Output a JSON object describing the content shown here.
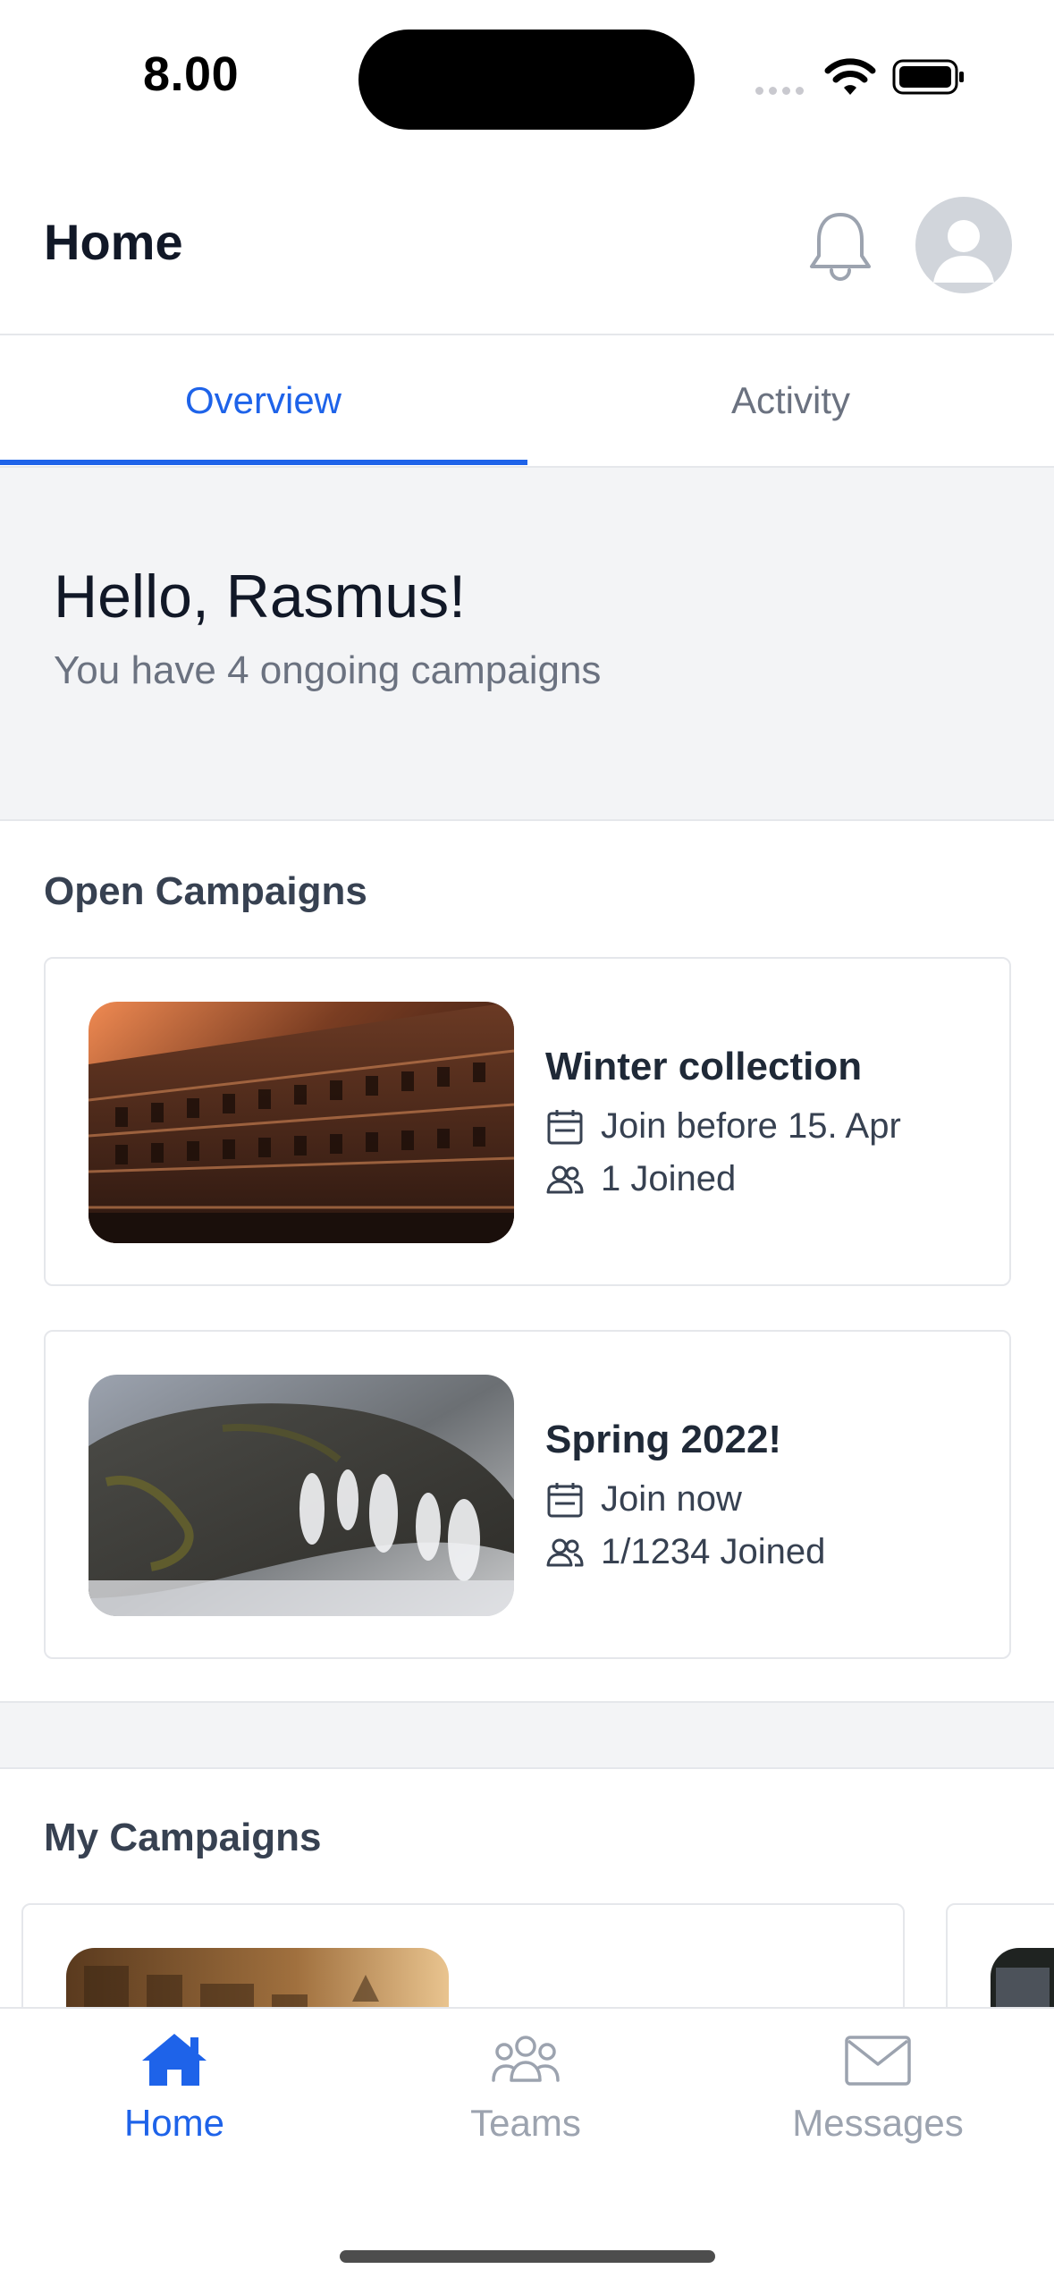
{
  "status_bar": {
    "time": "8.00"
  },
  "header": {
    "title": "Home"
  },
  "tabs": [
    {
      "label": "Overview",
      "active": true
    },
    {
      "label": "Activity",
      "active": false
    }
  ],
  "greeting": {
    "title": "Hello, Rasmus!",
    "subtitle": "You have 4 ongoing campaigns"
  },
  "open_campaigns": {
    "title": "Open Campaigns",
    "items": [
      {
        "name": "Winter collection",
        "date_text": "Join before 15. Apr",
        "joined_text": "1 Joined"
      },
      {
        "name": "Spring 2022!",
        "date_text": "Join now",
        "joined_text": "1/1234 Joined"
      }
    ]
  },
  "my_campaigns": {
    "title": "My Campaigns"
  },
  "bottom_nav": [
    {
      "label": "Home",
      "icon": "home-icon",
      "active": true
    },
    {
      "label": "Teams",
      "icon": "users-icon",
      "active": false
    },
    {
      "label": "Messages",
      "icon": "envelope-icon",
      "active": false
    }
  ],
  "colors": {
    "accent": "#1e63e9",
    "text_primary": "#111827",
    "text_muted": "#6b7280",
    "surface_alt": "#f3f4f6",
    "border": "#e5e7eb"
  }
}
